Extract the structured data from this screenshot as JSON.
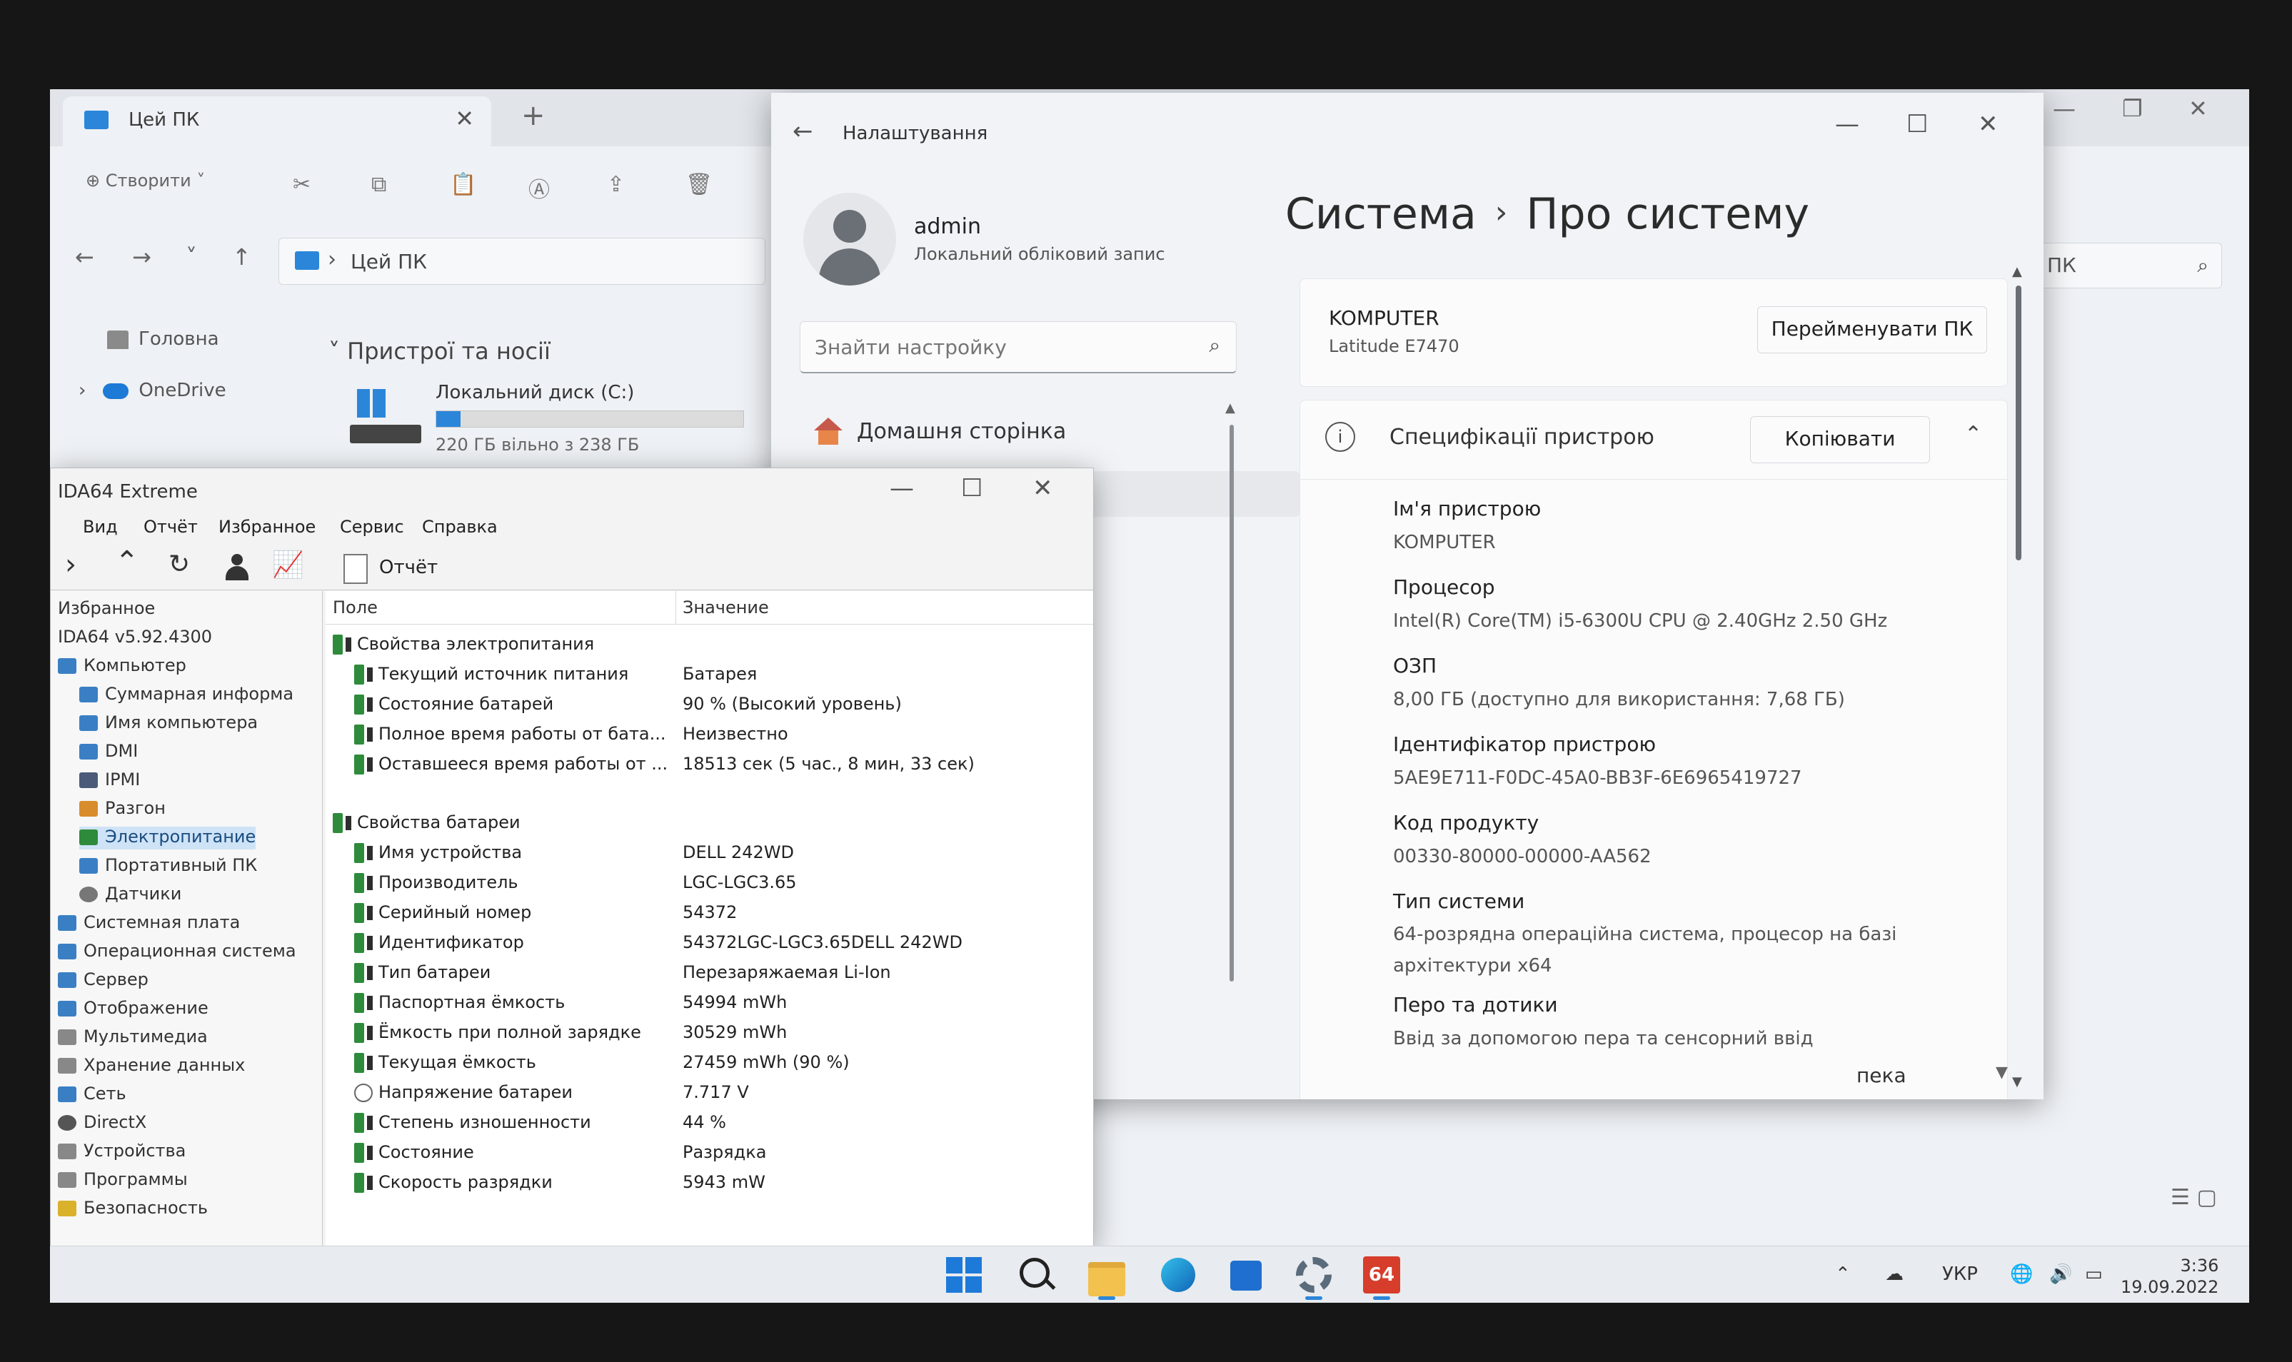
{
  "explorer": {
    "tab_title": "Цей ПК",
    "tab_close": "✕",
    "new_tab": "+",
    "create_label": "⊕ Створити ˅",
    "address": "Цей ПК",
    "sidebar": [
      {
        "label": "Головна"
      },
      {
        "label": "OneDrive"
      }
    ],
    "group_title": "Пристрої та носії",
    "drive": {
      "name": "Локальний диск (C:)",
      "free": "220 ГБ вільно з 238 ГБ",
      "used_fraction": 0.08
    },
    "search_placeholder": "ПК"
  },
  "settings": {
    "title": "Налаштування",
    "user_name": "admin",
    "user_desc": "Локальний обліковий запис",
    "search_placeholder": "Знайти настройку",
    "home_label": "Домашня сторінка",
    "bottom_nav_partial": "пека",
    "breadcrumb_parent": "Система",
    "breadcrumb_sep": "›",
    "breadcrumb_current": "Про систему",
    "device_name": "KOMPUTER",
    "device_model": "Latitude E7470",
    "rename_button": "Перейменувати ПК",
    "spec_title": "Специфікації пристрою",
    "copy_button": "Копіювати",
    "specs": [
      {
        "label": "Ім'я пристрою",
        "value": "KOMPUTER"
      },
      {
        "label": "Процесор",
        "value": "Intel(R) Core(TM) i5-6300U CPU @ 2.40GHz   2.50 GHz"
      },
      {
        "label": "ОЗП",
        "value": "8,00 ГБ (доступно для використання: 7,68 ГБ)"
      },
      {
        "label": "Ідентифікатор пристрою",
        "value": "5AE9E711-F0DC-45A0-BB3F-6E6965419727"
      },
      {
        "label": "Код продукту",
        "value": "00330-80000-00000-AA562"
      },
      {
        "label": "Тип системи",
        "value": "64-розрядна операційна система, процесор на базі архітектури x64"
      },
      {
        "label": "Перо та дотики",
        "value": "Ввід за допомогою пера та сенсорний ввід"
      }
    ]
  },
  "aida": {
    "title": "IDA64 Extreme",
    "menu": [
      "Вид",
      "Отчёт",
      "Избранное",
      "Сервис",
      "Справка"
    ],
    "report_label": "Отчёт",
    "tree": [
      {
        "label": "Избранное"
      },
      {
        "label": "IDA64 v5.92.4300"
      },
      {
        "label": "Компьютер"
      },
      {
        "label": "Суммарная информа"
      },
      {
        "label": "Имя компьютера"
      },
      {
        "label": "DMI"
      },
      {
        "label": "IPMI"
      },
      {
        "label": "Разгон"
      },
      {
        "label": "Электропитание"
      },
      {
        "label": "Портативный ПК"
      },
      {
        "label": "Датчики"
      },
      {
        "label": "Системная плата"
      },
      {
        "label": "Операционная система"
      },
      {
        "label": "Сервер"
      },
      {
        "label": "Отображение"
      },
      {
        "label": "Мультимедиа"
      },
      {
        "label": "Хранение данных"
      },
      {
        "label": "Сеть"
      },
      {
        "label": "DirectX"
      },
      {
        "label": "Устройства"
      },
      {
        "label": "Программы"
      },
      {
        "label": "Безопасность"
      }
    ],
    "col_field": "Поле",
    "col_value": "Значение",
    "power_group": "Свойства электропитания",
    "power_rows": [
      {
        "field": "Текущий источник питания",
        "value": "Батарея"
      },
      {
        "field": "Состояние батарей",
        "value": "90 % (Высокий уровень)"
      },
      {
        "field": "Полное время работы от бата...",
        "value": "Неизвестно"
      },
      {
        "field": "Оставшееся время работы от ...",
        "value": "18513 сек (5 час., 8 мин, 33 сек)"
      }
    ],
    "battery_group": "Свойства батареи",
    "battery_rows": [
      {
        "field": "Имя устройства",
        "value": "DELL 242WD"
      },
      {
        "field": "Производитель",
        "value": "LGC-LGC3.65"
      },
      {
        "field": "Серийный номер",
        "value": "54372"
      },
      {
        "field": "Идентификатор",
        "value": "54372LGC-LGC3.65DELL 242WD"
      },
      {
        "field": "Тип батареи",
        "value": "Перезаряжаемая Li-Ion"
      },
      {
        "field": "Паспортная ёмкость",
        "value": "54994 mWh"
      },
      {
        "field": "Ёмкость при полной зарядке",
        "value": "30529 mWh"
      },
      {
        "field": "Текущая ёмкость",
        "value": "27459 mWh  (90 %)"
      },
      {
        "field": "Напряжение батареи",
        "value": "7.717 V"
      },
      {
        "field": "Степень изношенности",
        "value": "44 %"
      },
      {
        "field": "Состояние",
        "value": "Разрядка"
      },
      {
        "field": "Скорость разрядки",
        "value": "5943 mW"
      }
    ]
  },
  "taskbar": {
    "aida_label": "64",
    "language": "УКР",
    "time": "3:36",
    "date": "19.09.2022"
  },
  "colors": {
    "accent": "#2b86d9",
    "battery_icon": "#2e8b3b",
    "aida_red": "#d63d2a"
  }
}
